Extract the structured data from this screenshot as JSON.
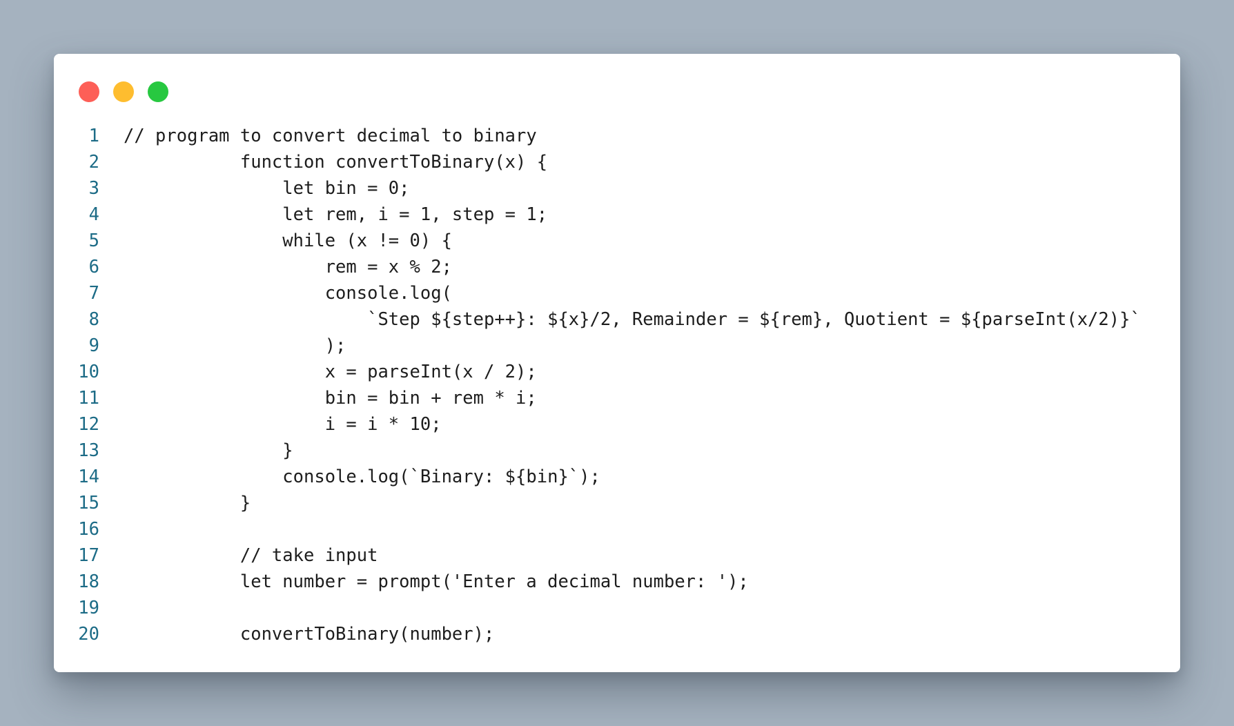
{
  "window": {
    "controls": [
      {
        "name": "close",
        "color": "#fd5f57"
      },
      {
        "name": "minimize",
        "color": "#febd2f"
      },
      {
        "name": "maximize",
        "color": "#27c840"
      }
    ]
  },
  "code_lines": [
    {
      "num": "1",
      "text": "// program to convert decimal to binary"
    },
    {
      "num": "2",
      "text": "           function convertToBinary(x) {"
    },
    {
      "num": "3",
      "text": "               let bin = 0;"
    },
    {
      "num": "4",
      "text": "               let rem, i = 1, step = 1;"
    },
    {
      "num": "5",
      "text": "               while (x != 0) {"
    },
    {
      "num": "6",
      "text": "                   rem = x % 2;"
    },
    {
      "num": "7",
      "text": "                   console.log("
    },
    {
      "num": "8",
      "text": "                       `Step ${step++}: ${x}/2, Remainder = ${rem}, Quotient = ${parseInt(x/2)}`"
    },
    {
      "num": "9",
      "text": "                   );"
    },
    {
      "num": "10",
      "text": "                   x = parseInt(x / 2);"
    },
    {
      "num": "11",
      "text": "                   bin = bin + rem * i;"
    },
    {
      "num": "12",
      "text": "                   i = i * 10;"
    },
    {
      "num": "13",
      "text": "               }"
    },
    {
      "num": "14",
      "text": "               console.log(`Binary: ${bin}`);"
    },
    {
      "num": "15",
      "text": "           }"
    },
    {
      "num": "16",
      "text": ""
    },
    {
      "num": "17",
      "text": "           // take input"
    },
    {
      "num": "18",
      "text": "           let number = prompt('Enter a decimal number: ');"
    },
    {
      "num": "19",
      "text": ""
    },
    {
      "num": "20",
      "text": "           convertToBinary(number);"
    }
  ]
}
